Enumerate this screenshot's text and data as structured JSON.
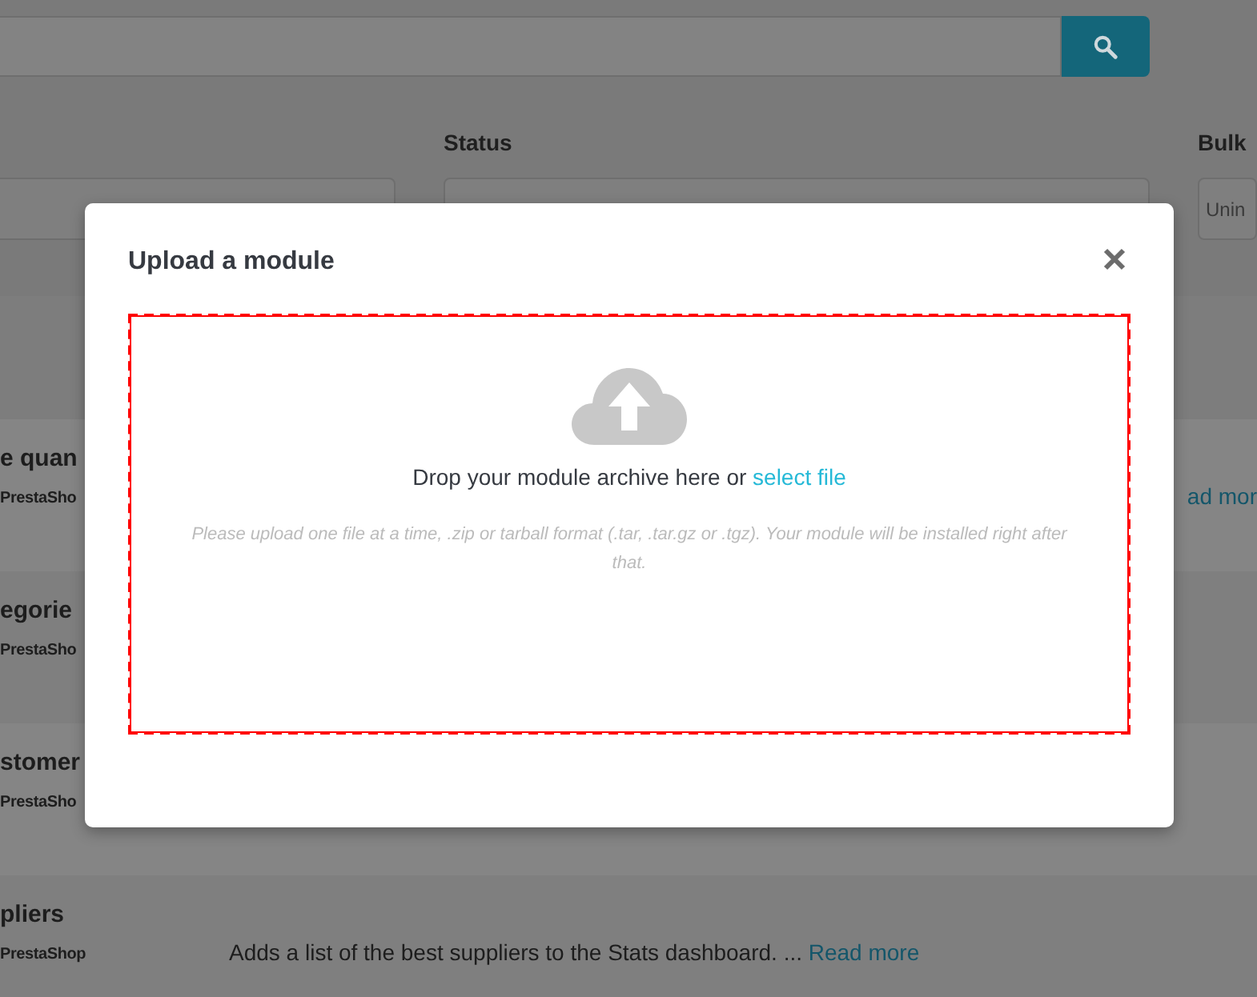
{
  "filters": [
    {
      "label": "Status"
    },
    {
      "label": "Bulk",
      "value": "Unin"
    }
  ],
  "modules": [
    {
      "name": "e quan",
      "author": "PrestaSho",
      "read_more": "ad mor"
    },
    {
      "name": "egorie",
      "author": "PrestaSho"
    },
    {
      "name": "stomer",
      "author": "PrestaSho"
    },
    {
      "name": "pliers",
      "author": "PrestaShop",
      "description": "Adds a list of the best suppliers to the Stats dashboard. ...",
      "read_more": "Read more"
    }
  ],
  "modal": {
    "title": "Upload a module",
    "dropzone": {
      "prompt": "Drop your module archive here or",
      "link": "select file",
      "hint": "Please upload one file at a time, .zip or tarball format (.tar, .tar.gz or .tgz). Your module will be installed right after that."
    }
  }
}
